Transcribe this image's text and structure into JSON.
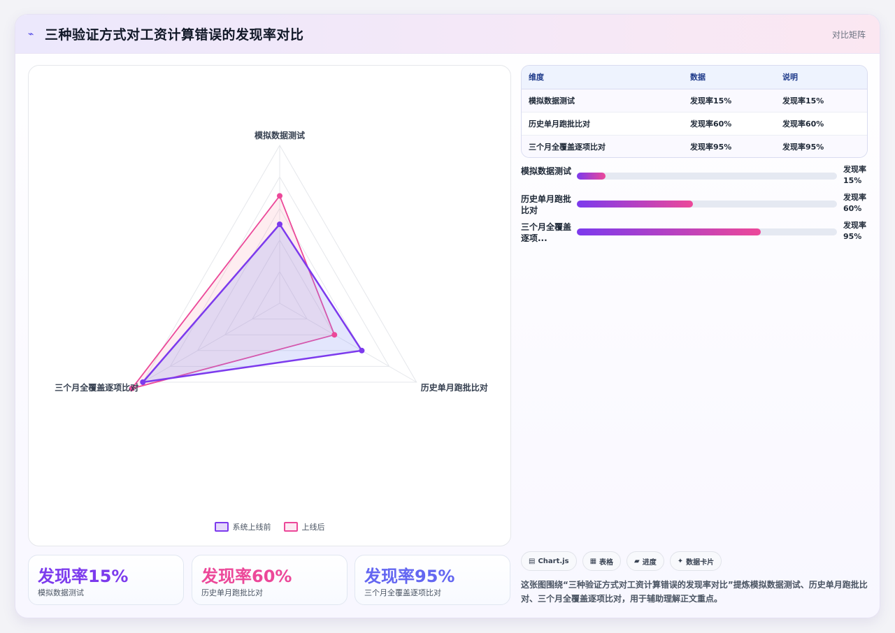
{
  "header": {
    "title": "三种验证方式对工资计算错误的发现率对比",
    "tag": "对比矩阵"
  },
  "colors": {
    "before": "#7c3aed",
    "after": "#ec4899",
    "stat1": "#7c3aed",
    "stat2": "#ec4899",
    "stat3": "#6366f1"
  },
  "chart_data": {
    "type": "radar",
    "categories": [
      "模拟数据测试",
      "历史单月跑批比对",
      "三个月全覆盖逐项比对"
    ],
    "series": [
      {
        "name": "系统上线前",
        "values": [
          50,
          60,
          100
        ]
      },
      {
        "name": "上线后",
        "values": [
          68,
          40,
          108
        ]
      }
    ],
    "rmax": 100,
    "grid_levels": 5,
    "legend": "bottom"
  },
  "stats": [
    {
      "value": "发现率15%",
      "label": "模拟数据测试"
    },
    {
      "value": "发现率60%",
      "label": "历史单月跑批比对"
    },
    {
      "value": "发现率95%",
      "label": "三个月全覆盖逐项比对"
    }
  ],
  "table": {
    "headers": [
      "维度",
      "数据",
      "说明"
    ],
    "rows": [
      [
        "模拟数据测试",
        "发现率15%",
        "发现率15%"
      ],
      [
        "历史单月跑批比对",
        "发现率60%",
        "发现率60%"
      ],
      [
        "三个月全覆盖逐项比对",
        "发现率95%",
        "发现率95%"
      ]
    ]
  },
  "bars": [
    {
      "label": "模拟数据测试",
      "value_text": "发现率15%",
      "fraction": 0.11
    },
    {
      "label": "历史单月跑批比对",
      "value_text": "发现率60%",
      "fraction": 0.446
    },
    {
      "label": "三个月全覆盖逐项...",
      "value_text": "发现率95%",
      "fraction": 0.707
    }
  ],
  "chips": [
    {
      "icon": "▤",
      "label": "Chart.js"
    },
    {
      "icon": "▦",
      "label": "表格"
    },
    {
      "icon": "▰",
      "label": "进度"
    },
    {
      "icon": "✦",
      "label": "数据卡片"
    }
  ],
  "note": "这张图围绕“三种验证方式对工资计算错误的发现率对比”提炼模拟数据测试、历史单月跑批比对、三个月全覆盖逐项比对，用于辅助理解正文重点。"
}
